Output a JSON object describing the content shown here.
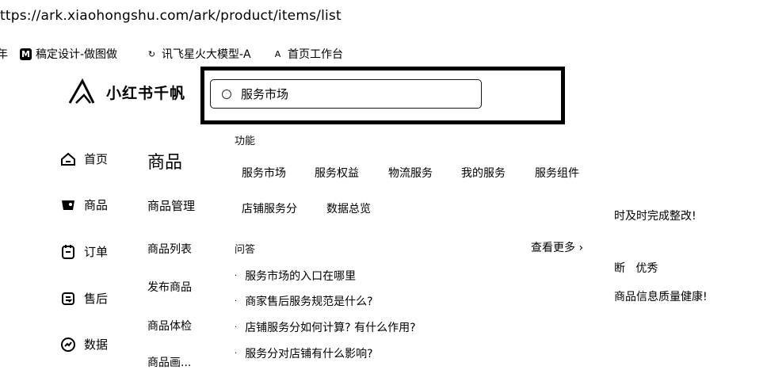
{
  "browser": {
    "url": "ttps://ark.xiaohongshu.com/ark/product/items/list",
    "bookmarks": [
      {
        "icon": "mastergo-icon",
        "glyph": "M",
        "label": "稿定设计-做图做"
      },
      {
        "icon": "spark-icon",
        "glyph": "↻",
        "label": "讯飞星火大模型-A"
      },
      {
        "icon": "workbench-icon",
        "glyph": "A",
        "label": "首页工作台"
      }
    ],
    "bookmark_edge": "年"
  },
  "app": {
    "logo_text": "小红书千帆"
  },
  "search": {
    "value": "服务市场",
    "placeholder": ""
  },
  "sidebar": {
    "items": [
      {
        "label": "首页",
        "icon": "home-icon"
      },
      {
        "label": "商品",
        "icon": "product-icon"
      },
      {
        "label": "订单",
        "icon": "order-icon"
      },
      {
        "label": "售后",
        "icon": "aftersale-icon"
      },
      {
        "label": "数据",
        "icon": "data-icon"
      }
    ]
  },
  "section": {
    "title": "商品",
    "items": [
      "商品管理",
      "商品列表",
      "发布商品",
      "商品体检",
      "商品画..."
    ]
  },
  "dropdown": {
    "function_label": "功能",
    "functions": [
      "服务市场",
      "服务权益",
      "物流服务",
      "我的服务",
      "服务组件",
      "店铺服务分",
      "数据总览"
    ],
    "qa_label": "问答",
    "more_label": "查看更多 ›",
    "questions": [
      "服务市场的入口在哪里",
      "商家售后服务规范是什么?",
      "店铺服务分如何计算? 有什么作用?",
      "服务分对店铺有什么影响?"
    ]
  },
  "right_panel": {
    "notice1": "时及时完成整改!",
    "notice2_prefix": "断",
    "notice2_status": "优秀",
    "notice3": "商品信息质量健康!"
  }
}
